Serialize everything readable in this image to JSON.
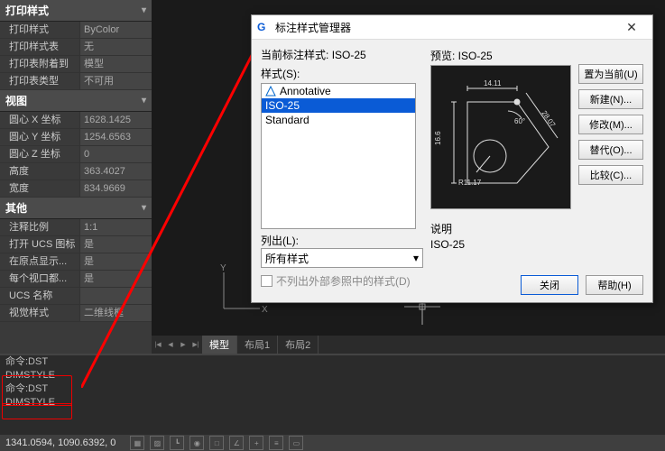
{
  "props": {
    "section1": {
      "title": "打印样式",
      "rows": [
        {
          "label": "打印样式",
          "val": "ByColor"
        },
        {
          "label": "打印样式表",
          "val": "无"
        },
        {
          "label": "打印表附着到",
          "val": "模型"
        },
        {
          "label": "打印表类型",
          "val": "不可用"
        }
      ]
    },
    "section2": {
      "title": "视图",
      "rows": [
        {
          "label": "圆心 X 坐标",
          "val": "1628.1425"
        },
        {
          "label": "圆心 Y 坐标",
          "val": "1254.6563"
        },
        {
          "label": "圆心 Z 坐标",
          "val": "0"
        },
        {
          "label": "高度",
          "val": "363.4027"
        },
        {
          "label": "宽度",
          "val": "834.9669"
        }
      ]
    },
    "section3": {
      "title": "其他",
      "rows": [
        {
          "label": "注释比例",
          "val": "1:1"
        },
        {
          "label": "打开 UCS 图标",
          "val": "是"
        },
        {
          "label": "在原点显示...",
          "val": "是"
        },
        {
          "label": "每个视口都...",
          "val": "是"
        },
        {
          "label": "UCS 名称",
          "val": ""
        },
        {
          "label": "视觉样式",
          "val": "二维线框"
        }
      ]
    }
  },
  "tabs": {
    "model": "模型",
    "layout1": "布局1",
    "layout2": "布局2"
  },
  "cmd": {
    "l1": "命令:DST",
    "l2": "DIMSTYLE",
    "l3": "命令:DST",
    "l4": "DIMSTYLE"
  },
  "status": {
    "coord": "1341.0594, 1090.6392, 0"
  },
  "dialog": {
    "title": "标注样式管理器",
    "current_label": "当前标注样式:",
    "current_val": "ISO-25",
    "styles_label": "样式(S):",
    "items": {
      "a": "Annotative",
      "b": "ISO-25",
      "c": "Standard"
    },
    "listout_label": "列出(L):",
    "listout_val": "所有样式",
    "chk_label": "不列出外部参照中的样式(D)",
    "preview_label": "预览: ISO-25",
    "desc_label": "说明",
    "desc_val": "ISO-25",
    "btns": {
      "setcur": "置为当前(U)",
      "new": "新建(N)...",
      "modify": "修改(M)...",
      "override": "替代(O)...",
      "compare": "比较(C)..."
    },
    "close": "关闭",
    "help": "帮助(H)"
  },
  "preview_dims": {
    "w": "14.11",
    "h": "16.6",
    "r": "R11.17",
    "ang": "60°",
    "diag": "28.07"
  }
}
